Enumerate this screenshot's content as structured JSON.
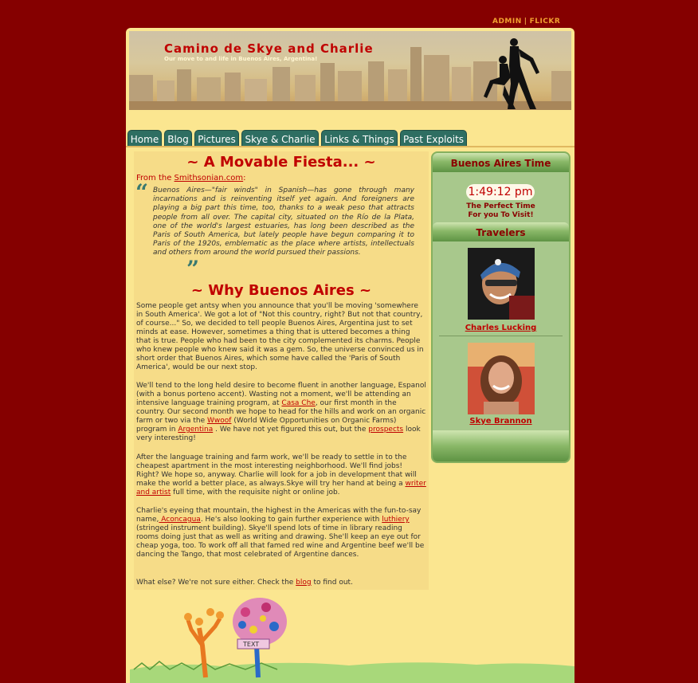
{
  "toplinks": {
    "admin": "ADMIN",
    "sep": "|",
    "flickr": "FLICKR"
  },
  "header": {
    "title": "Camino de Skye and Charlie",
    "subtitle": "Our move to and life in Buenos Aires, Argentina!"
  },
  "nav": [
    "Home",
    "Blog",
    "Pictures",
    "Skye & Charlie",
    "Links & Things",
    "Past Exploits"
  ],
  "main": {
    "heading1": "~ A Movable Fiesta... ~",
    "from_prefix": "From the ",
    "from_link": "Smithsonian.com",
    "from_suffix": ":",
    "quote": "Buenos Aires—\"fair winds\" in Spanish—has gone through many incarnations and is reinventing itself yet again. And foreigners are playing a big part this time, too, thanks to a weak peso that attracts people from all over. The capital city, situated on the Río de la Plata, one of the world's largest estuaries, has long been described as the Paris of South America, but lately people have begun comparing it to Paris of the 1920s, emblematic as the place where artists, intellectuals and others from around the world pursued their passions.",
    "heading2": "~ Why Buenos Aires ~",
    "p1": "Some people get antsy when you announce that you'll be moving 'somewhere in South America'. We got a lot of \"Not this country, right? But not that country, of course...\" So, we decided to tell people Buenos Aires, Argentina just to set minds at ease. However, sometimes a thing that is uttered becomes a thing that is true. People who had been to the city complemented its charms. People who knew people who knew said it was a gem. So, the universe convinced us in short order that Buenos Aires, which some have called the 'Paris of South America', would be our next stop.",
    "p2": {
      "t1": "We'll tend to the long held desire to become fluent in another language, Espanol (with a bonus porteno accent). Wasting not a moment, we'll be attending an intensive language training program, at ",
      "l1": "Casa Che",
      "t2": ", our first month in the country. Our second month we hope to head for the hills and work on an organic farm or two via the ",
      "l2": "Wwoof",
      "t3": " (World Wide Opportunities on Organic Farms) program in ",
      "l3": "Argentina",
      "t4": " . We have not yet figured this out, but the ",
      "l4": "prospects",
      "t5": " look very interesting!"
    },
    "p3": {
      "t1": "After the language training and farm work, we'll be ready to settle in to the cheapest apartment in the most interesting neighborhood. We'll find jobs! Right? We hope so, anyway. Charlie will look for a job in development that will make the world a better place, as always.Skye will try her hand at being a ",
      "l1": "writer and artist",
      "t2": " full time, with the requisite night or online job."
    },
    "p4": {
      "t1": "Charlie's eyeing that mountain, the highest in the Americas with the fun-to-say name,",
      "l1": " Aconcagua",
      "t2": ". He's also looking to gain further experience with ",
      "l2": "luthiery",
      "t3": " (stringed instrument building). Skye'll spend lots of time in library reading rooms doing just that as well as writing and drawing. She'll keep an eye out for cheap yoga, too. To work off all that famed red wine and Argentine beef we'll be dancing the Tango, that most celebrated of Argentine dances."
    },
    "p5": {
      "t1": "What else? We're not sure either. Check the ",
      "l1": "blog",
      "t2": " to find out."
    }
  },
  "sidebar": {
    "time_heading": "Buenos Aires Time",
    "clock": "1:49:12 pm",
    "perfect_line1": "The Perfect Time",
    "perfect_line2": "For you To Visit!",
    "travelers_heading": "Travelers",
    "traveler1": "Charles Lucking",
    "traveler2": "Skye Brannon"
  },
  "footer": {
    "sign_text": "TEXT"
  }
}
